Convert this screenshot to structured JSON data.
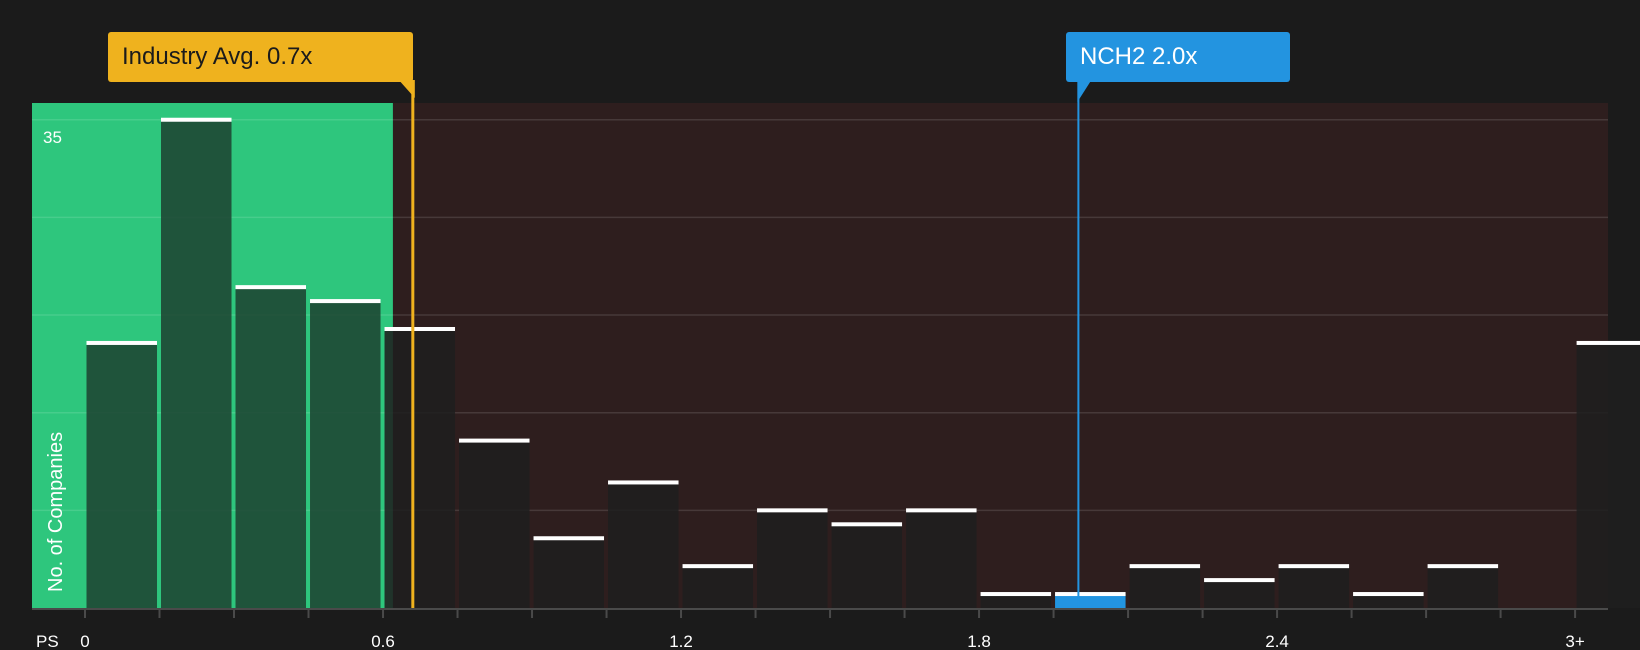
{
  "chart_data": {
    "type": "bar",
    "xlabel": "PS",
    "ylabel": "No. of Companies",
    "x_ticks": [
      "0",
      "0.6",
      "1.2",
      "1.8",
      "2.4",
      "3+"
    ],
    "y_ticks": [
      "35"
    ],
    "ylim": [
      0,
      36.2
    ],
    "bin_width": 0.15,
    "bins": [
      {
        "x": 0.0,
        "value": 19
      },
      {
        "x": 0.15,
        "value": 35
      },
      {
        "x": 0.3,
        "value": 23
      },
      {
        "x": 0.45,
        "value": 22
      },
      {
        "x": 0.6,
        "value": 20
      },
      {
        "x": 0.75,
        "value": 12
      },
      {
        "x": 0.9,
        "value": 5
      },
      {
        "x": 1.05,
        "value": 9
      },
      {
        "x": 1.2,
        "value": 3
      },
      {
        "x": 1.35,
        "value": 7
      },
      {
        "x": 1.5,
        "value": 6
      },
      {
        "x": 1.65,
        "value": 7
      },
      {
        "x": 1.8,
        "value": 1
      },
      {
        "x": 1.95,
        "value": 1,
        "highlight": true
      },
      {
        "x": 2.1,
        "value": 3
      },
      {
        "x": 2.25,
        "value": 2
      },
      {
        "x": 2.4,
        "value": 3
      },
      {
        "x": 2.55,
        "value": 1
      },
      {
        "x": 2.7,
        "value": 3
      },
      {
        "x": 3.0,
        "value": 19
      }
    ],
    "industry_avg": {
      "label": "Industry Avg. 0.7x",
      "value": 0.66
    },
    "company": {
      "label": "NCH2 2.0x",
      "value": 2.0
    },
    "fair_range_max": 0.62,
    "grid": true,
    "colors": {
      "background": "#1b1b1b",
      "good_zone": "#2ec67d",
      "bad_zone": "#2e1e1e",
      "bar": "#1f1f1f",
      "bar_top": "#ffffff",
      "industry": "#efb21e",
      "company": "#2394e0"
    }
  }
}
